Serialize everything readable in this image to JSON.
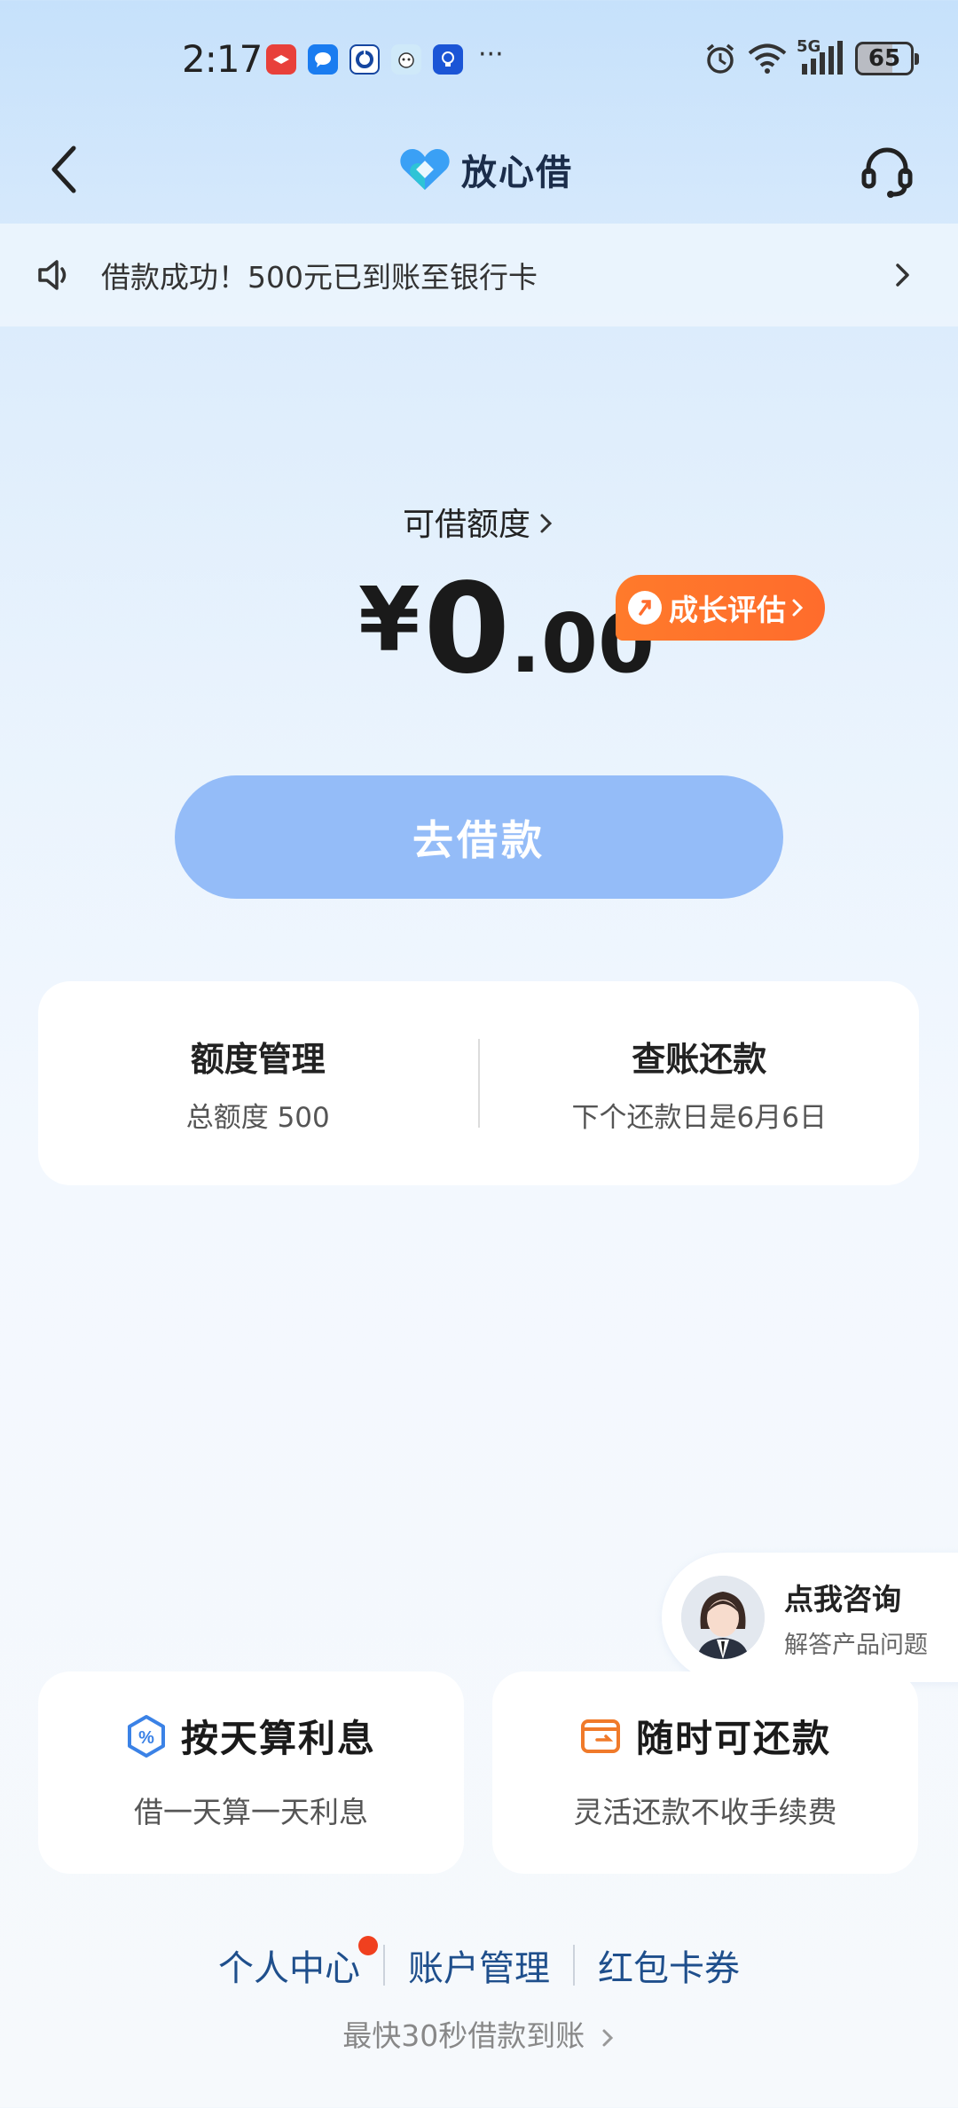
{
  "status_bar": {
    "time": "2:17",
    "battery": "65",
    "network": "5G"
  },
  "header": {
    "brand": "放心借",
    "brand_color": "#3aa0f5"
  },
  "notice": {
    "text": "借款成功！500元已到账至银行卡"
  },
  "limit": {
    "label": "可借额度",
    "currency": "¥",
    "integer": "0",
    "decimal": ".00",
    "growth_badge": "成长评估"
  },
  "borrow_button": {
    "label": "去借款"
  },
  "manage_card": {
    "left_title": "额度管理",
    "left_sub": "总额度 500",
    "right_title": "查账还款",
    "right_sub": "下个还款日是6月6日"
  },
  "consult": {
    "title": "点我咨询",
    "sub": "解答产品问题"
  },
  "features": [
    {
      "title": "按天算利息",
      "sub": "借一天算一天利息",
      "icon": "percent-shield-icon"
    },
    {
      "title": "随时可还款",
      "sub": "灵活还款不收手续费",
      "icon": "wallet-icon"
    }
  ],
  "bottom_links": [
    {
      "label": "个人中心",
      "has_badge": true
    },
    {
      "label": "账户管理"
    },
    {
      "label": "红包卡券"
    }
  ],
  "footer_tip": "最快30秒借款到账",
  "colors": {
    "accent_orange": "#ff6c2c",
    "button_blue": "#94bcf8",
    "link_blue": "#1f4f8c"
  }
}
